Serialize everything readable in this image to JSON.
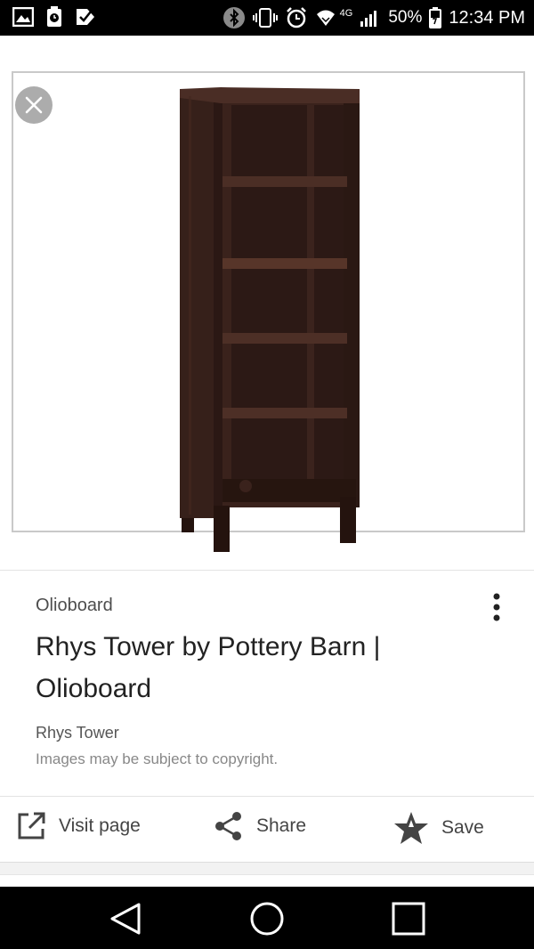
{
  "status_bar": {
    "battery": "50%",
    "time": "12:34 PM",
    "network": "4G",
    "icons": [
      "gallery-icon",
      "clock-app-icon",
      "check-app-icon",
      "bluetooth-icon",
      "vibrate-icon",
      "alarm-icon",
      "wifi-icon",
      "signal-icon",
      "battery-icon"
    ]
  },
  "viewer": {
    "close_icon": "close-icon",
    "image_alt": "Rhys Tower bookcase"
  },
  "result": {
    "source": "Olioboard",
    "title": "Rhys Tower by Pottery Barn | Olioboard",
    "subtitle": "Rhys Tower",
    "copyright": "Images may be subject to copyright."
  },
  "actions": {
    "visit_label": "Visit page",
    "share_label": "Share",
    "save_label": "Save"
  },
  "colors": {
    "wood_dark": "#2e1a16",
    "wood_mid": "#3d241e",
    "text_primary": "#222222",
    "text_secondary": "#4d4d4d"
  }
}
